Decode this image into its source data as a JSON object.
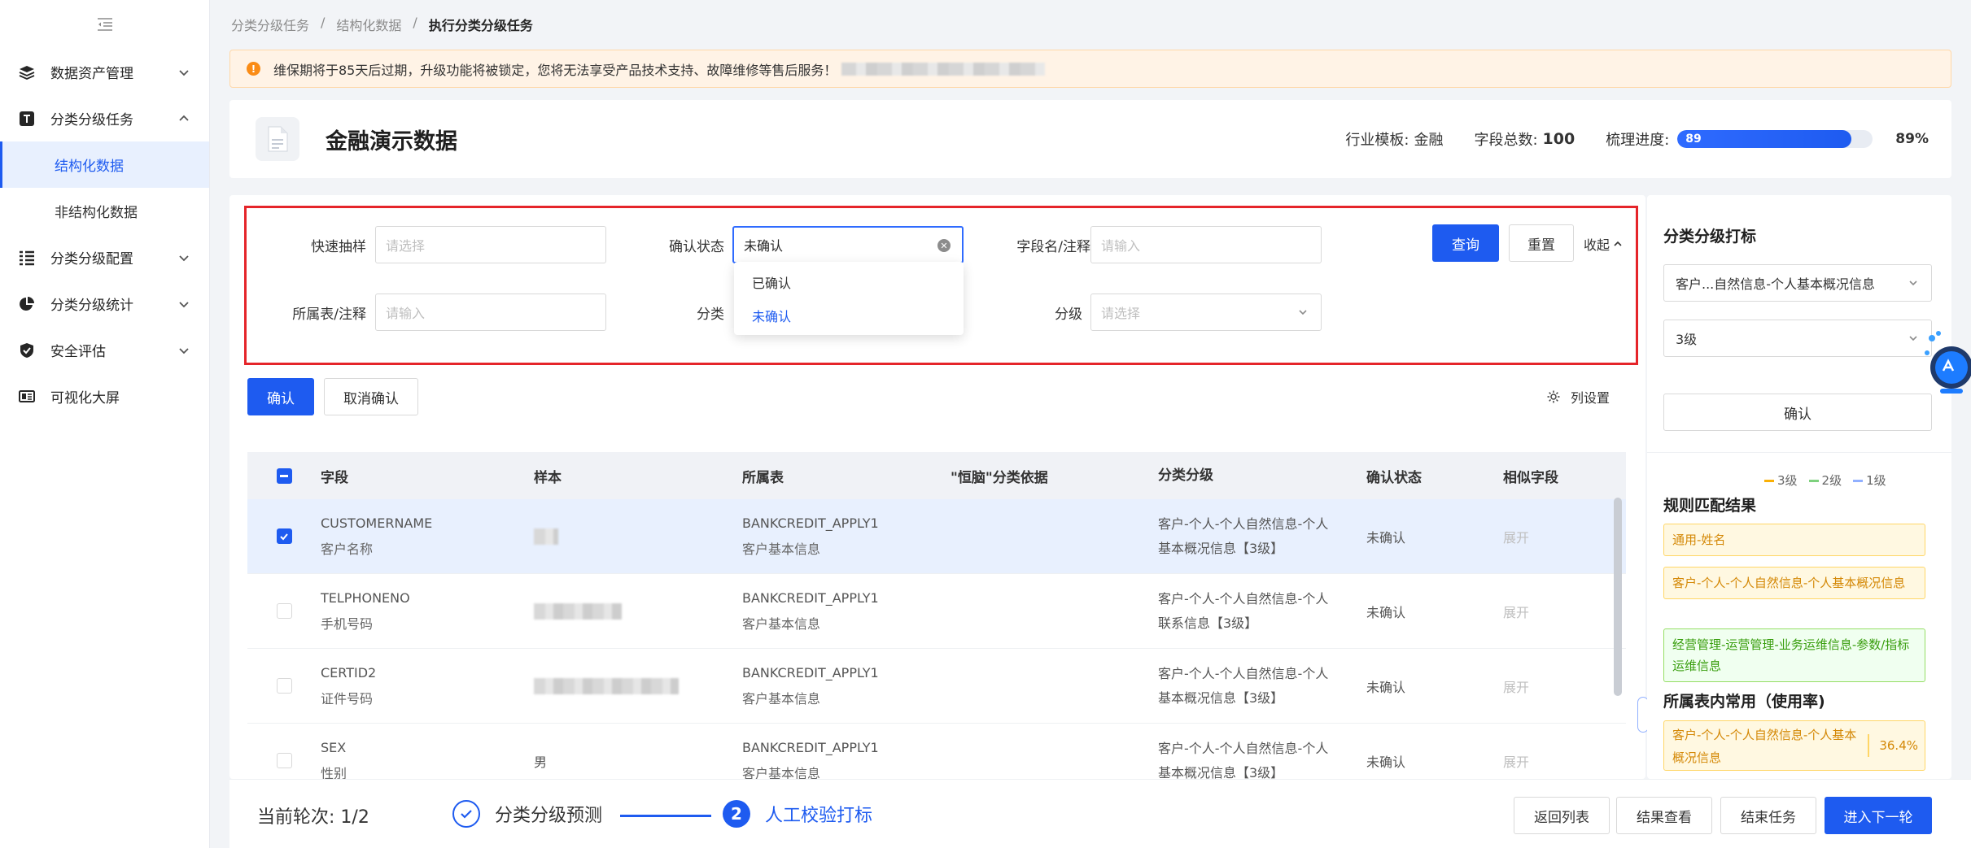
{
  "sidebar": {
    "items": [
      {
        "label": "数据资产管理",
        "icon": "layers-icon",
        "expanded": false
      },
      {
        "label": "分类分级任务",
        "icon": "text-box-icon",
        "expanded": true
      },
      {
        "label": "分类分级配置",
        "icon": "list-settings-icon",
        "expanded": false
      },
      {
        "label": "分类分级统计",
        "icon": "pie-chart-icon",
        "expanded": false
      },
      {
        "label": "安全评估",
        "icon": "shield-check-icon",
        "expanded": false
      },
      {
        "label": "可视化大屏",
        "icon": "screen-icon"
      }
    ],
    "subitems": [
      {
        "label": "结构化数据",
        "active": true
      },
      {
        "label": "非结构化数据",
        "active": false
      }
    ]
  },
  "breadcrumb": [
    "分类分级任务",
    "结构化数据",
    "执行分类分级任务"
  ],
  "breadcrumb_sep": "/",
  "notice": {
    "text": "维保期将于85天后过期，升级功能将被锁定，您将无法享受产品技术支持、故障维修等售后服务！"
  },
  "header": {
    "title": "金融演示数据",
    "template_label": "行业模板:",
    "template_value": "金融",
    "fields_label": "字段总数:",
    "fields_value": "100",
    "progress_label": "梳理进度:",
    "progress_value": 89,
    "progress_text": "89",
    "progress_pct": "89%"
  },
  "filters": {
    "quick_sample_label": "快速抽样",
    "quick_sample_placeholder": "请选择",
    "confirm_status_label": "确认状态",
    "confirm_status_value": "未确认",
    "field_name_label": "字段名/注释",
    "field_name_placeholder": "请输入",
    "table_label": "所属表/注释",
    "table_placeholder": "请输入",
    "category_label": "分类",
    "level_label": "分级",
    "level_placeholder": "请选择",
    "query_label": "查询",
    "reset_label": "重置",
    "collapse_label": "收起",
    "dropdown_options": [
      "已确认",
      "未确认"
    ]
  },
  "actions": {
    "confirm_label": "确认",
    "cancel_confirm_label": "取消确认",
    "column_settings_label": "列设置"
  },
  "table": {
    "columns": [
      "字段",
      "样本",
      "所属表",
      "\"恒脑\"分类依据",
      "分类分级",
      "确认状态",
      "相似字段"
    ],
    "rows": [
      {
        "field": "CUSTOMERNAME",
        "field_cn": "客户名称",
        "sample": "",
        "table": "BANKCREDIT_APPLY1",
        "table_cn": "客户基本信息",
        "class1": "客户-个人-个人自然信息-个人",
        "class2": "基本概况信息【3级】",
        "status": "未确认",
        "similar": "展开",
        "checked": true,
        "sample_w": 30
      },
      {
        "field": "TELPHONENO",
        "field_cn": "手机号码",
        "sample": "",
        "table": "BANKCREDIT_APPLY1",
        "table_cn": "客户基本信息",
        "class1": "客户-个人-个人自然信息-个人",
        "class2": "联系信息【3级】",
        "status": "未确认",
        "similar": "展开",
        "checked": false,
        "sample_w": 108
      },
      {
        "field": "CERTID2",
        "field_cn": "证件号码",
        "sample": "",
        "table": "BANKCREDIT_APPLY1",
        "table_cn": "客户基本信息",
        "class1": "客户-个人-个人自然信息-个人",
        "class2": "基本概况信息【3级】",
        "status": "未确认",
        "similar": "展开",
        "checked": false,
        "sample_w": 178
      },
      {
        "field": "SEX",
        "field_cn": "性别",
        "sample": "男",
        "table": "BANKCREDIT_APPLY1",
        "table_cn": "客户基本信息",
        "class1": "客户-个人-个人自然信息-个人",
        "class2": "基本概况信息【3级】",
        "status": "未确认",
        "similar": "展开",
        "checked": false,
        "sample_w": 0
      }
    ]
  },
  "right_panel": {
    "title": "分类分级打标",
    "category_value": "客户...自然信息-个人基本概况信息",
    "level_value": "3级",
    "confirm_label": "确认",
    "legend": [
      "3级",
      "2级",
      "1级"
    ],
    "rule_title": "规则匹配结果",
    "rules": [
      {
        "text": "通用-姓名",
        "color": "yellow"
      },
      {
        "text": "客户-个人-个人自然信息-个人基本概况信息",
        "color": "yellow"
      },
      {
        "text": "经营管理-运营管理-业务运维信息-参数/指标运维信息",
        "color": "green"
      }
    ],
    "usage_title": "所属表内常用（使用率)",
    "usage_item": "客户-个人-个人自然信息-个人基本概况信息",
    "usage_pct": "36.4%"
  },
  "footer": {
    "round_label": "当前轮次:",
    "round_value": "1/2",
    "step1_label": "分类分级预测",
    "step2_label": "人工校验打标",
    "step2_num": "2",
    "buttons": [
      "返回列表",
      "结果查看",
      "结束任务",
      "进入下一轮"
    ]
  },
  "colors": {
    "primary": "#1e5bf0",
    "highlight": "#e5252a",
    "warning": "#fa8c16"
  }
}
